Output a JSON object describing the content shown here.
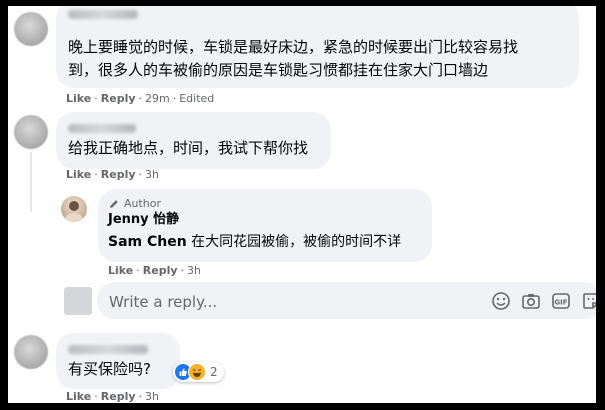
{
  "comments": [
    {
      "text_lines": [
        "晚上要睡觉的时候，车锁是最好床边，紧急的时候要出门比较容易找",
        "到，很多人的车被偷的原因是车锁匙习惯都挂在住家大门口墙边"
      ],
      "actions": {
        "like": "Like",
        "reply": "Reply",
        "time": "29m",
        "edited": "Edited"
      }
    },
    {
      "text": "给我正确地点，时间，我试下帮你找",
      "actions": {
        "like": "Like",
        "reply": "Reply",
        "time": "3h"
      }
    },
    {
      "text": "有买保险吗?",
      "reaction_count": "2",
      "actions": {
        "like": "Like",
        "reply": "Reply",
        "time": "3h"
      }
    }
  ],
  "reply": {
    "author_badge": "Author",
    "name": "Jenny 怡静",
    "mention": "Sam Chen",
    "text": " 在大同花园被偷，被偷的时间不详",
    "actions": {
      "like": "Like",
      "reply": "Reply",
      "time": "3h"
    }
  },
  "reply_box": {
    "placeholder": "Write a reply..."
  },
  "icons": [
    "emoji-icon",
    "camera-icon",
    "gif-icon",
    "sticker-icon"
  ],
  "colors": {
    "bubble": "#f0f2f5",
    "muted": "#65676b",
    "like_blue": "#1877f2",
    "haha_yellow": "#f7b125"
  }
}
